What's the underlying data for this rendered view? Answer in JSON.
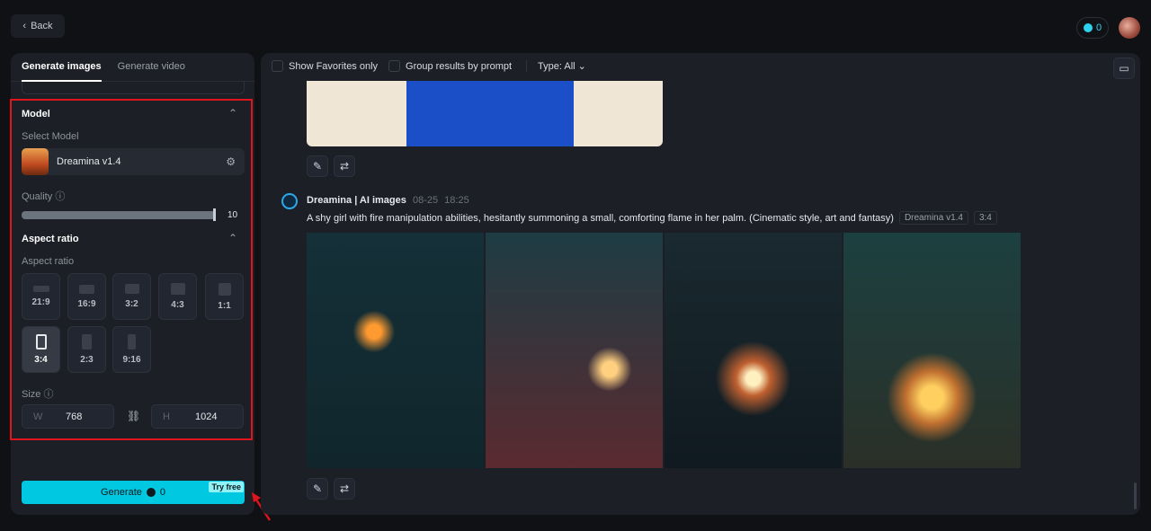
{
  "header": {
    "back_label": "Back",
    "credits": "0"
  },
  "left": {
    "tabs": [
      {
        "label": "Generate images",
        "active": true
      },
      {
        "label": "Generate video",
        "active": false
      }
    ],
    "model_section": {
      "title": "Model",
      "select_label": "Select Model",
      "model_name": "Dreamina v1.4"
    },
    "quality": {
      "label": "Quality",
      "value": "10",
      "fraction": 1.0
    },
    "aspect": {
      "title": "Aspect ratio",
      "label": "Aspect ratio",
      "options": [
        "21:9",
        "16:9",
        "3:2",
        "4:3",
        "1:1",
        "3:4",
        "2:3",
        "9:16"
      ],
      "selected": "3:4"
    },
    "size": {
      "label": "Size",
      "w_prefix": "W",
      "w": "768",
      "h_prefix": "H",
      "h": "1024"
    },
    "generate": {
      "label": "Generate",
      "cost": "0",
      "badge": "Try free"
    }
  },
  "right": {
    "toolbar": {
      "favorites": "Show Favorites only",
      "group": "Group results by prompt",
      "type": "Type: All"
    },
    "result": {
      "author": "Dreamina | AI images",
      "date": "08-25",
      "time": "18:25",
      "prompt": "A shy girl with fire manipulation abilities, hesitantly summoning a small, comforting flame in her palm. (Cinematic style, art and fantasy)",
      "model_tag": "Dreamina v1.4",
      "ratio_tag": "3:4"
    }
  },
  "colors": {
    "accent": "#00c8e0",
    "highlight_box": "#e0141c"
  }
}
